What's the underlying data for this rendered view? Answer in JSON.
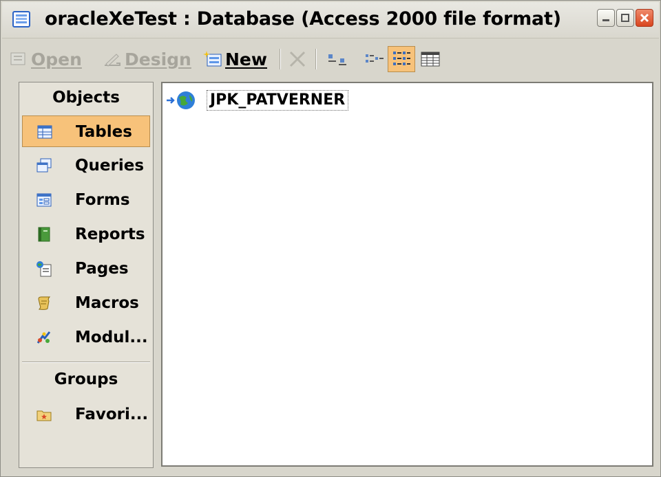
{
  "window": {
    "title": "oracleXeTest : Database (Access 2000 file format)"
  },
  "toolbar": {
    "open_label": "Open",
    "design_label": "Design",
    "new_label": "New"
  },
  "objects_panel": {
    "objects_header": "Objects",
    "items": [
      {
        "label": "Tables",
        "icon": "tables-icon",
        "selected": true
      },
      {
        "label": "Queries",
        "icon": "queries-icon"
      },
      {
        "label": "Forms",
        "icon": "forms-icon"
      },
      {
        "label": "Reports",
        "icon": "reports-icon"
      },
      {
        "label": "Pages",
        "icon": "pages-icon"
      },
      {
        "label": "Macros",
        "icon": "macros-icon"
      },
      {
        "label": "Modul...",
        "icon": "modules-icon"
      }
    ],
    "groups_header": "Groups",
    "groups": [
      {
        "label": "Favori...",
        "icon": "favorites-icon"
      }
    ]
  },
  "objects_list": {
    "items": [
      {
        "name": "JPK_PATVERNER",
        "icon": "linked-table-icon"
      }
    ]
  },
  "colors": {
    "selected_bg": "#f7c27a",
    "panel_bg": "#e5e2d8",
    "window_bg": "#d8d6cc"
  }
}
